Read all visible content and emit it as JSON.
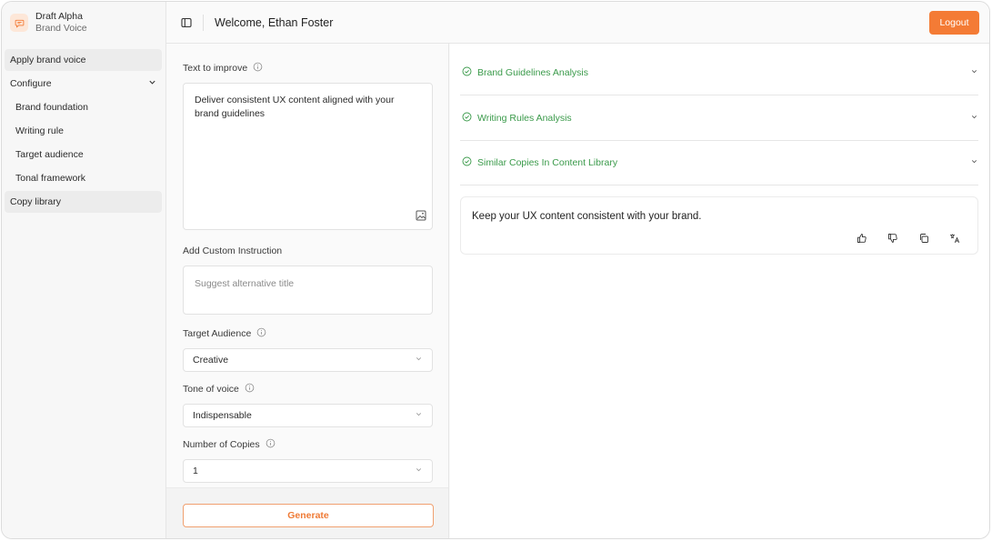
{
  "brand": {
    "title": "Draft Alpha",
    "subtitle": "Brand Voice",
    "logo_icon": "chat-bubble-icon",
    "logo_bg": "#fde7d8"
  },
  "sidebar": {
    "items": [
      {
        "label": "Apply brand voice"
      },
      {
        "label": "Configure"
      },
      {
        "label": "Brand foundation"
      },
      {
        "label": "Writing rule"
      },
      {
        "label": "Target audience"
      },
      {
        "label": "Tonal framework"
      },
      {
        "label": "Copy library"
      }
    ]
  },
  "header": {
    "welcome": "Welcome, Ethan Foster",
    "logout_label": "Logout",
    "accent": "#f47b35"
  },
  "form": {
    "text_label": "Text to improve",
    "text_value": "Deliver consistent UX content aligned with your brand guidelines",
    "custom_label": "Add Custom Instruction",
    "custom_placeholder": "Suggest alternative title",
    "audience_label": "Target Audience",
    "audience_value": "Creative",
    "tone_label": "Tone of voice",
    "tone_value": "Indispensable",
    "copies_label": "Number of Copies",
    "copies_value": "1",
    "generate_label": "Generate"
  },
  "results": {
    "accordions": [
      {
        "title": "Brand Guidelines Analysis"
      },
      {
        "title": "Writing Rules Analysis"
      },
      {
        "title": "Similar Copies In Content Library"
      }
    ],
    "success_color": "#3a9a4a",
    "output_text": "Keep your UX content consistent with your brand.",
    "actions": [
      "thumbs-up-icon",
      "thumbs-down-icon",
      "copy-icon",
      "translate-icon"
    ]
  }
}
